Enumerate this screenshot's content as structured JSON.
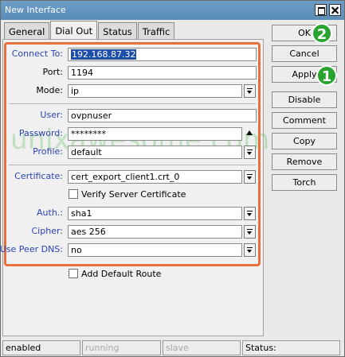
{
  "window": {
    "title": "New Interface"
  },
  "tabs": [
    {
      "label": "General"
    },
    {
      "label": "Dial Out"
    },
    {
      "label": "Status"
    },
    {
      "label": "Traffic"
    }
  ],
  "form": {
    "connect_to": {
      "label": "Connect To:",
      "value": "192.168.87.32"
    },
    "port": {
      "label": "Port:",
      "value": "1194"
    },
    "mode": {
      "label": "Mode:",
      "value": "ip"
    },
    "user": {
      "label": "User:",
      "value": "ovpnuser"
    },
    "password": {
      "label": "Password:",
      "value": "********"
    },
    "profile": {
      "label": "Profile:",
      "value": "default"
    },
    "certificate": {
      "label": "Certificate:",
      "value": "cert_export_client1.crt_0"
    },
    "verify_cert": {
      "label": "Verify Server Certificate",
      "checked": false
    },
    "auth": {
      "label": "Auth.:",
      "value": "sha1"
    },
    "cipher": {
      "label": "Cipher:",
      "value": "aes 256"
    },
    "use_peer_dns": {
      "label": "Use Peer DNS:",
      "value": "no"
    },
    "add_default_route": {
      "label": "Add Default Route",
      "checked": false
    }
  },
  "buttons": {
    "ok": "OK",
    "cancel": "Cancel",
    "apply": "Apply",
    "disable": "Disable",
    "comment": "Comment",
    "copy": "Copy",
    "remove": "Remove",
    "torch": "Torch"
  },
  "badges": {
    "ok_step": "2",
    "apply_step": "1",
    "color": "#27a32e"
  },
  "highlight_color": "#e8703a",
  "watermark": "unixawesome.com",
  "status": {
    "state": "enabled",
    "running": "running",
    "slave": "slave",
    "status_label": "Status:"
  }
}
